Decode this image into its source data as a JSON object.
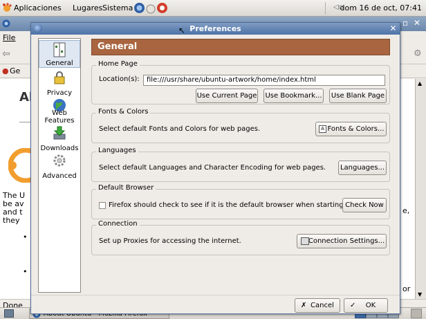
{
  "top_panel": {
    "menus": [
      "Aplicaciones",
      "Lugares",
      "Sistema"
    ],
    "clock": "dom 16 de oct, 07:41"
  },
  "firefox": {
    "menu_file": "File",
    "bookmark_ge": "Ge",
    "content_a": "Al",
    "content_lines": [
      "The U",
      "be av",
      "and t",
      "they"
    ],
    "right_frag_1": "e,",
    "right_frag_2": "or",
    "status": "Done"
  },
  "taskbar": {
    "task_label": "About Ubuntu - Mozilla Firefox"
  },
  "dialog": {
    "title": "Preferences",
    "sidebar": [
      {
        "label": "General"
      },
      {
        "label": "Privacy"
      },
      {
        "label": "Web Features"
      },
      {
        "label": "Downloads"
      },
      {
        "label": "Advanced"
      }
    ],
    "header": "General",
    "home_page": {
      "title": "Home Page",
      "location_label": "Location(s):",
      "location_value": "file:///usr/share/ubuntu-artwork/home/index.html",
      "use_current": "Use Current Page",
      "use_bookmark": "Use Bookmark...",
      "use_blank": "Use Blank Page"
    },
    "fonts_colors": {
      "title": "Fonts & Colors",
      "text": "Select default Fonts and Colors for web pages.",
      "button": "Fonts & Colors..."
    },
    "languages": {
      "title": "Languages",
      "text": "Select default Languages and Character Encoding for web pages.",
      "button": "Languages..."
    },
    "default_browser": {
      "title": "Default Browser",
      "checkbox_label": "Firefox should check to see if it is the default browser when starting.",
      "checked": false,
      "button": "Check Now"
    },
    "connection": {
      "title": "Connection",
      "text": "Set up Proxies for accessing the internet.",
      "button": "Connection Settings..."
    },
    "cancel": "Cancel",
    "ok": "OK"
  }
}
